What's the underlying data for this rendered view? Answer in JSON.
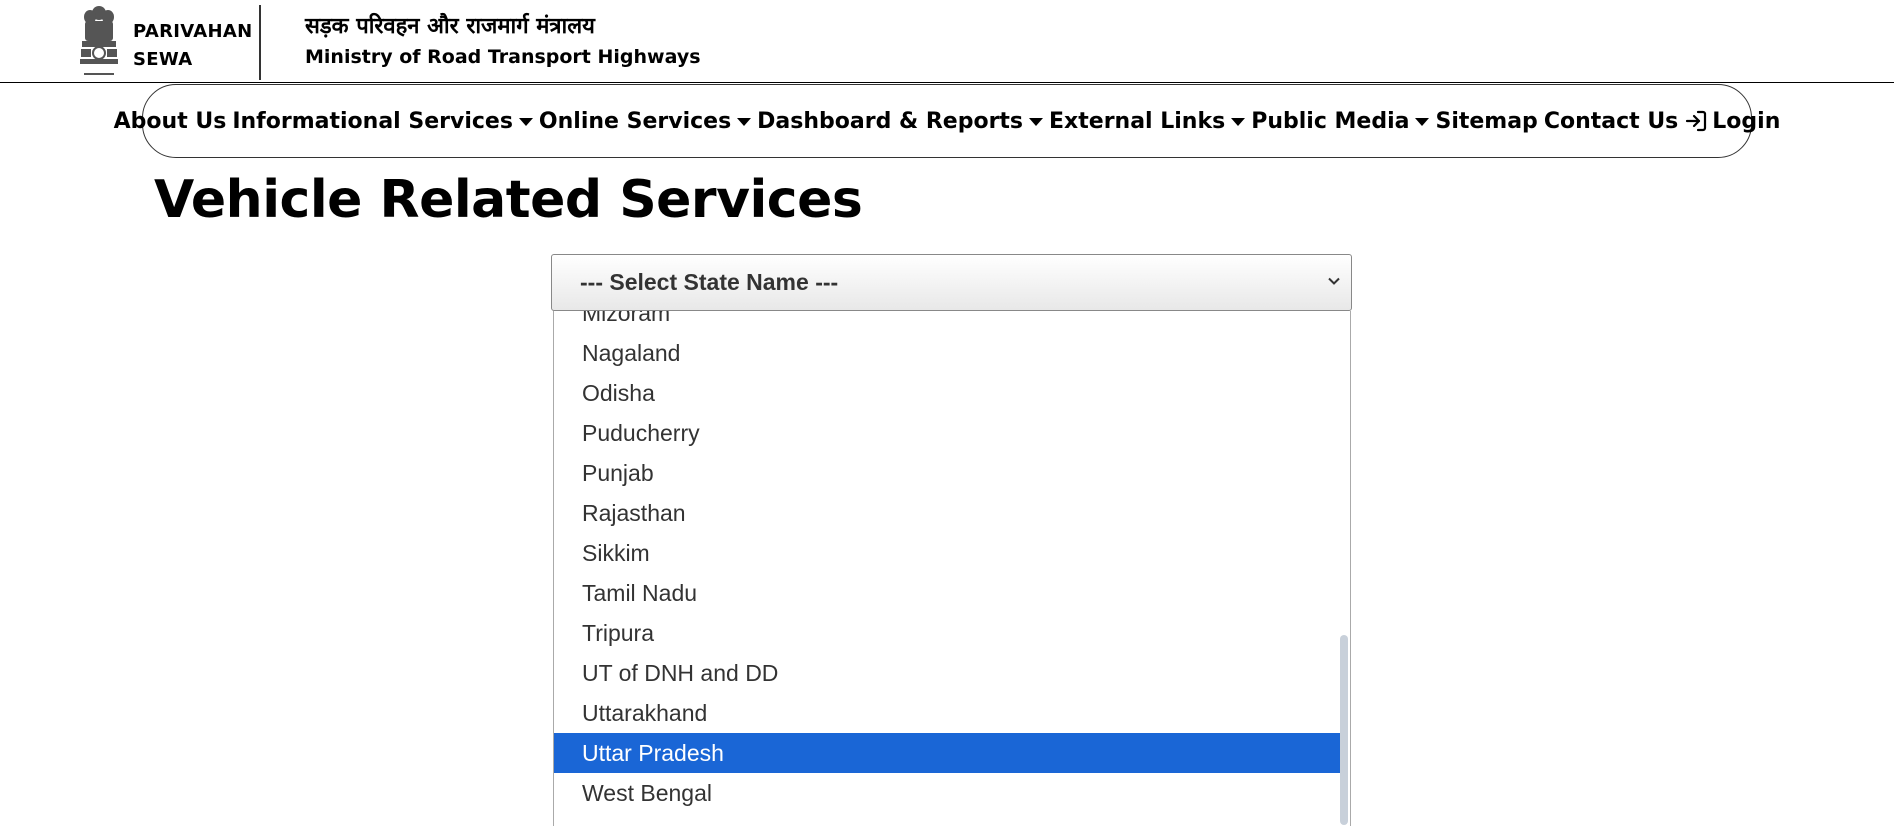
{
  "header": {
    "brand_line1": "PARIVAHAN",
    "brand_line2": "SEWA",
    "ministry_hindi": "सड़क परिवहन और राजमार्ग मंत्रालय",
    "ministry_english": "Ministry of Road Transport Highways",
    "emblem_icon": "national-emblem-icon"
  },
  "nav": {
    "items": [
      {
        "label": "About Us",
        "dropdown": false
      },
      {
        "label": "Informational Services",
        "dropdown": true
      },
      {
        "label": "Online Services",
        "dropdown": true
      },
      {
        "label": "Dashboard & Reports",
        "dropdown": true
      },
      {
        "label": "External Links",
        "dropdown": true
      },
      {
        "label": "Public Media",
        "dropdown": true
      },
      {
        "label": "Sitemap",
        "dropdown": false
      },
      {
        "label": "Contact Us",
        "dropdown": false
      },
      {
        "label": "Login",
        "dropdown": false,
        "icon": "login-icon"
      }
    ]
  },
  "page": {
    "title": "Vehicle Related Services"
  },
  "state_select": {
    "selected_label": "--- Select State Name ---",
    "highlighted_option": "Uttar Pradesh",
    "highlight_color": "#1a66d6",
    "visible_options": [
      "Mizoram",
      "Nagaland",
      "Odisha",
      "Puducherry",
      "Punjab",
      "Rajasthan",
      "Sikkim",
      "Tamil Nadu",
      "Tripura",
      "UT of DNH and DD",
      "Uttarakhand",
      "Uttar Pradesh",
      "West Bengal"
    ]
  }
}
